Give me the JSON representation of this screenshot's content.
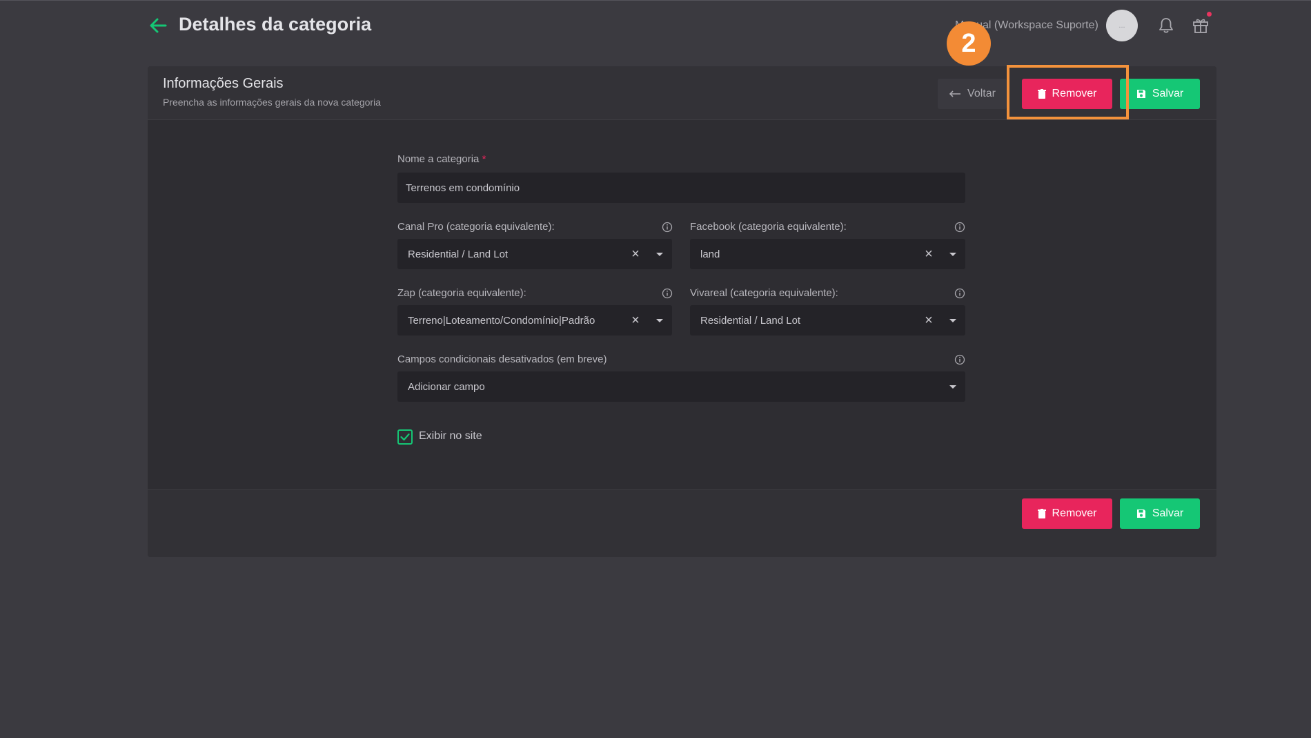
{
  "header": {
    "title": "Detalhes da categoria",
    "workspace": "Manual (Workspace Suporte)",
    "avatar_initials": "..."
  },
  "card": {
    "title": "Informações Gerais",
    "subtitle": "Preencha as informações gerais da nova categoria",
    "buttons": {
      "voltar": "Voltar",
      "remover": "Remover",
      "salvar": "Salvar"
    }
  },
  "annotation": {
    "step": "2"
  },
  "form": {
    "name": {
      "label": "Nome a categoria",
      "required_mark": "*",
      "value": "Terrenos em condomínio"
    },
    "canal_pro": {
      "label": "Canal Pro (categoria equivalente):",
      "value": "Residential / Land Lot"
    },
    "facebook": {
      "label": "Facebook (categoria equivalente):",
      "value": "land"
    },
    "zap": {
      "label": "Zap (categoria equivalente):",
      "value": "Terreno|Loteamento/Condomínio|Padrão"
    },
    "vivareal": {
      "label": "Vivareal (categoria equivalente):",
      "value": "Residential / Land Lot"
    },
    "campos": {
      "label": "Campos condicionais desativados (em breve)",
      "placeholder": "Adicionar campo"
    },
    "exibir": {
      "label": "Exibir no site",
      "checked": true
    }
  },
  "footer": {
    "remover": "Remover",
    "salvar": "Salvar"
  },
  "colors": {
    "accent_green": "#15c775",
    "danger_pink": "#e8255c",
    "highlight_orange": "#f3923c"
  }
}
